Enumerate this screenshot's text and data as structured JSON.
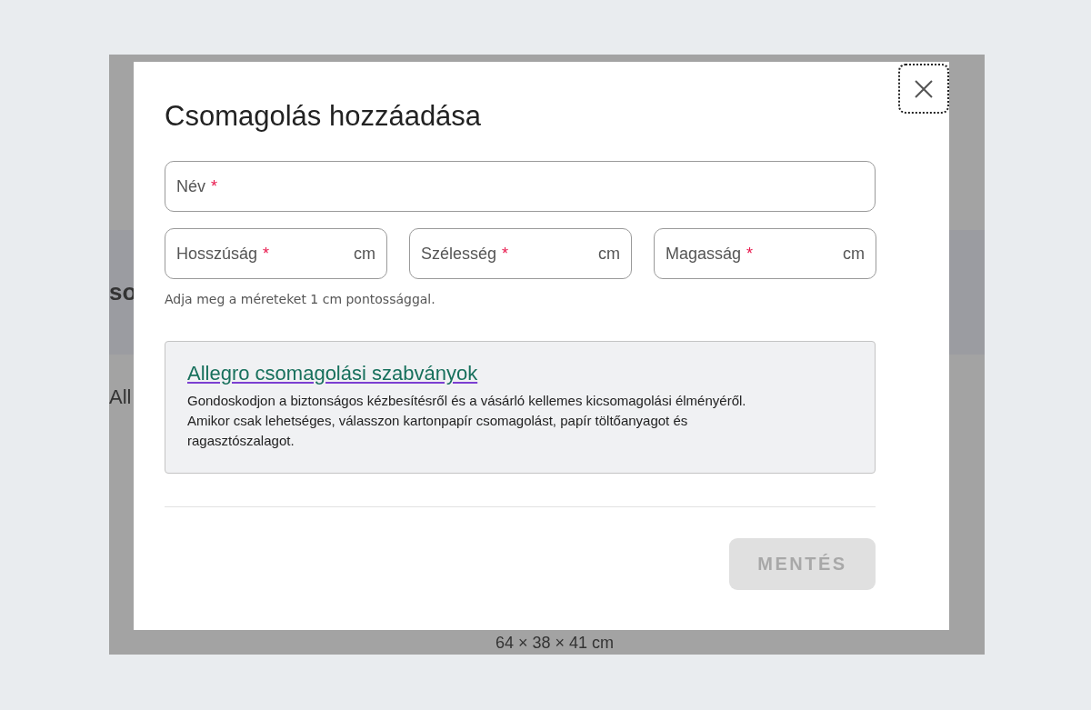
{
  "background": {
    "texts": [
      "so",
      "All"
    ],
    "dimensions": "64 × 38 × 41 cm"
  },
  "dialog": {
    "title": "Csomagolás hozzáadása",
    "required_mark": "*",
    "name_field": {
      "label": "Név",
      "required": true
    },
    "dimension_fields": [
      {
        "label": "Hosszúság",
        "required": true,
        "unit": "cm"
      },
      {
        "label": "Szélesség",
        "required": true,
        "unit": "cm"
      },
      {
        "label": "Magasság",
        "required": true,
        "unit": "cm"
      }
    ],
    "hint": "Adja meg a méreteket 1 cm pontossággal.",
    "info": {
      "link": "Allegro csomagolási szabványok",
      "text": "Gondoskodjon a biztonságos kézbesítésről és a vásárló kellemes kicsomagolási élményéről. Amikor csak lehetséges, válasszon kartonpapír csomagolást, papír töltőanyagot és ragasztószalagot."
    },
    "save_button": {
      "label": "MENTÉS",
      "disabled": true
    }
  }
}
